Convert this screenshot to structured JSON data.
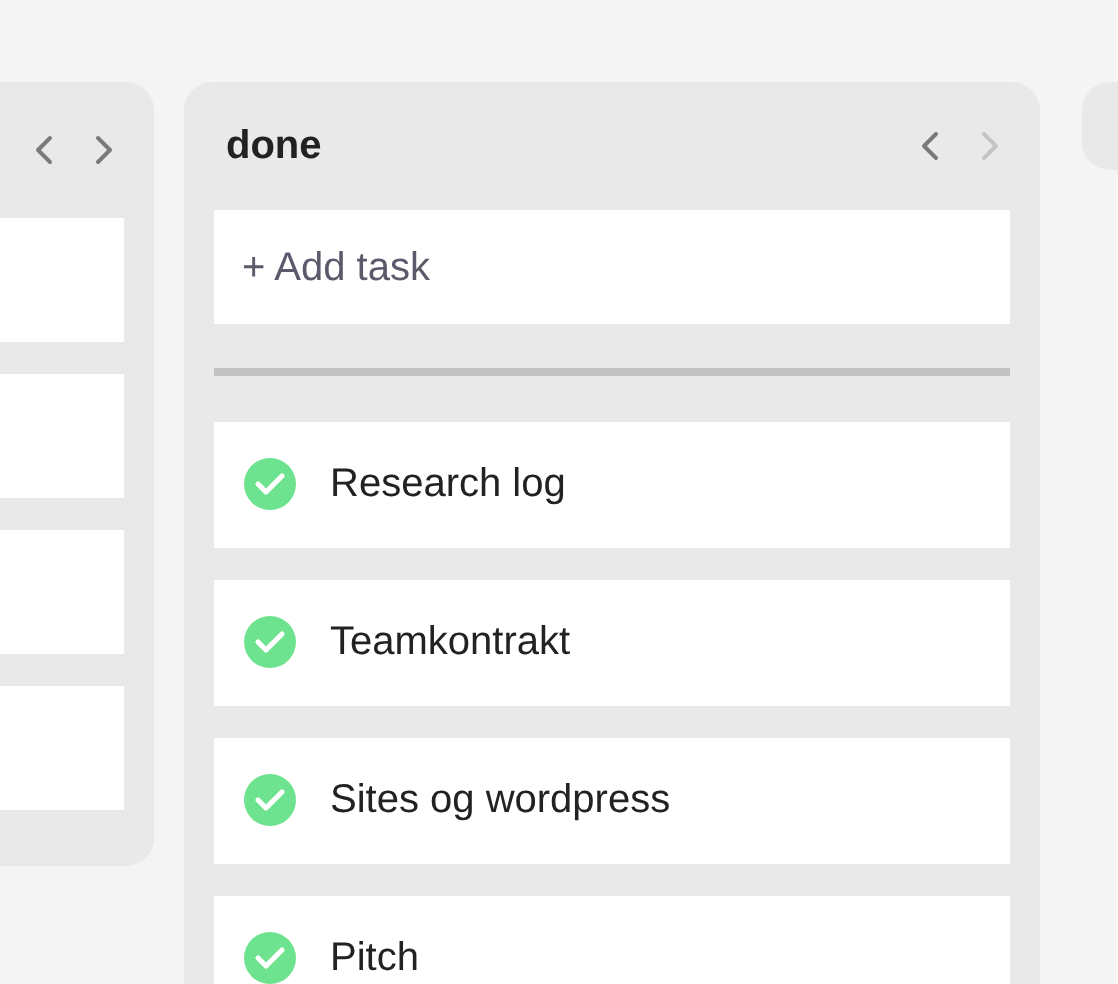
{
  "columns": [
    {
      "kind": "partial",
      "nav": {
        "previous_disabled": false,
        "next_disabled": false
      },
      "cards": [
        {
          "kind": "blank"
        },
        {
          "kind": "blank"
        },
        {
          "kind": "blank"
        },
        {
          "kind": "blank"
        }
      ]
    },
    {
      "kind": "full",
      "title": "done",
      "nav": {
        "previous_disabled": false,
        "next_disabled": true
      },
      "add_task": "+ Add task",
      "tasks": [
        {
          "title": "Research log",
          "done": true
        },
        {
          "title": "Teamkontrakt",
          "done": true
        },
        {
          "title": "Sites og wordpress",
          "done": true
        },
        {
          "title": "Pitch",
          "done": true
        }
      ]
    },
    {
      "kind": "stub"
    }
  ]
}
